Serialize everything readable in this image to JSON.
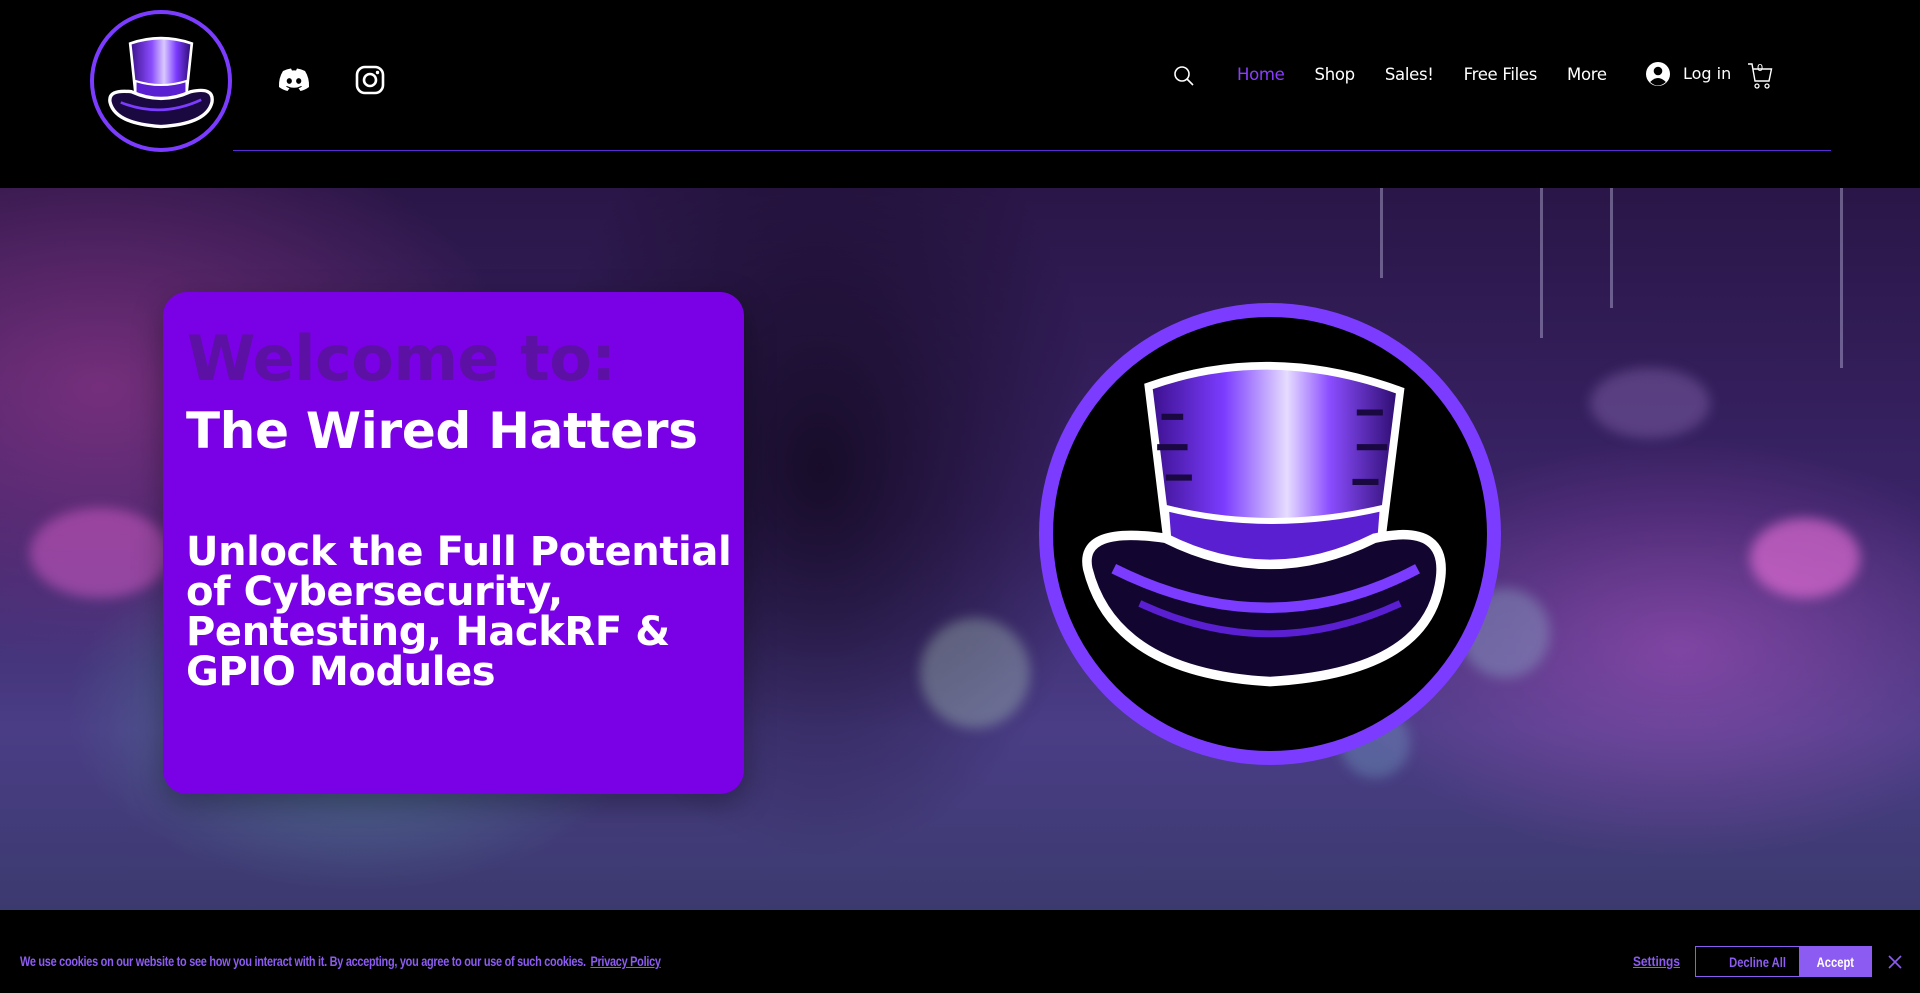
{
  "header": {
    "logo_alt": "The Wired Hatters logo",
    "social": [
      {
        "icon": "discord-icon"
      },
      {
        "icon": "instagram-icon"
      }
    ],
    "nav": [
      {
        "label": "Home",
        "active": true
      },
      {
        "label": "Shop",
        "active": false
      },
      {
        "label": "Sales!",
        "active": false
      },
      {
        "label": "Free Files",
        "active": false
      },
      {
        "label": "More",
        "active": false
      }
    ],
    "login_label": "Log in",
    "cart_count": "0"
  },
  "hero": {
    "eyebrow": "Welcome to:",
    "title": "The Wired Hatters",
    "body": "Unlock the Full Potential of Cybersecurity, Pentesting, HackRF & GPIO Modules"
  },
  "cookie": {
    "text": "We use cookies on our website to see how you interact with it. By accepting, you agree to our use of such cookies.",
    "privacy_link": "Privacy Policy",
    "settings_label": "Settings",
    "decline_label": "Decline All",
    "accept_label": "Accept"
  },
  "colors": {
    "accent": "#7b3cff",
    "card": "#7a00e6",
    "nav_active": "#8a3dff",
    "cookie_text": "#8c5cf2"
  }
}
